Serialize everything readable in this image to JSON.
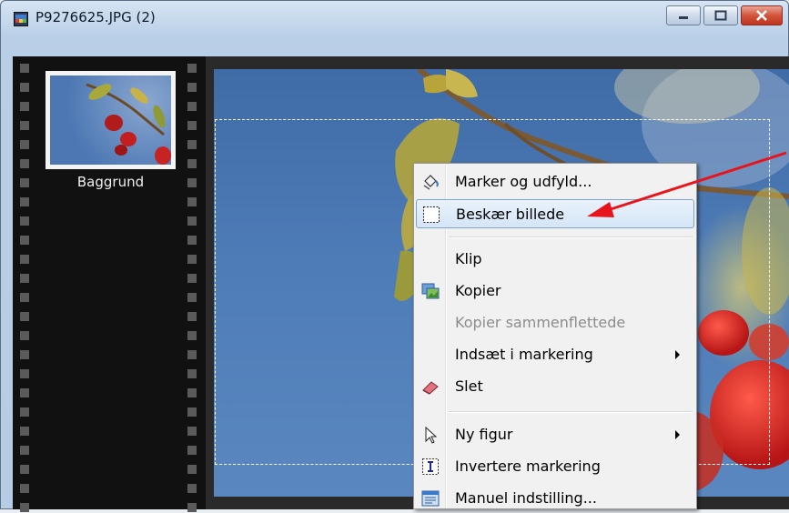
{
  "window": {
    "title": "P9276625.JPG (2)"
  },
  "filmstrip": {
    "layer_label": "Baggrund"
  },
  "context_menu": {
    "items": [
      {
        "label": "Marker og udfyld...",
        "icon": "fill-bucket-icon",
        "enabled": true
      },
      {
        "label": "Beskær billede",
        "icon": "crop-selection-icon",
        "enabled": true,
        "highlighted": true
      },
      {
        "label": "Klip",
        "icon": "",
        "enabled": true
      },
      {
        "label": "Kopier",
        "icon": "copy-image-icon",
        "enabled": true
      },
      {
        "label": "Kopier sammenflettede",
        "icon": "",
        "enabled": false
      },
      {
        "label": "Indsæt i markering",
        "icon": "",
        "enabled": true,
        "submenu": true
      },
      {
        "label": "Slet",
        "icon": "eraser-icon",
        "enabled": true
      },
      {
        "label": "Ny figur",
        "icon": "pointer-icon",
        "enabled": true,
        "submenu": true
      },
      {
        "label": "Invertere markering",
        "icon": "invert-icon",
        "enabled": true
      },
      {
        "label": "Manuel indstilling...",
        "icon": "manual-settings-icon",
        "enabled": true
      }
    ]
  },
  "colors": {
    "highlight_border": "#7da2ce",
    "annotation_arrow": "#e8141b",
    "sky": "#4e7cb7"
  }
}
